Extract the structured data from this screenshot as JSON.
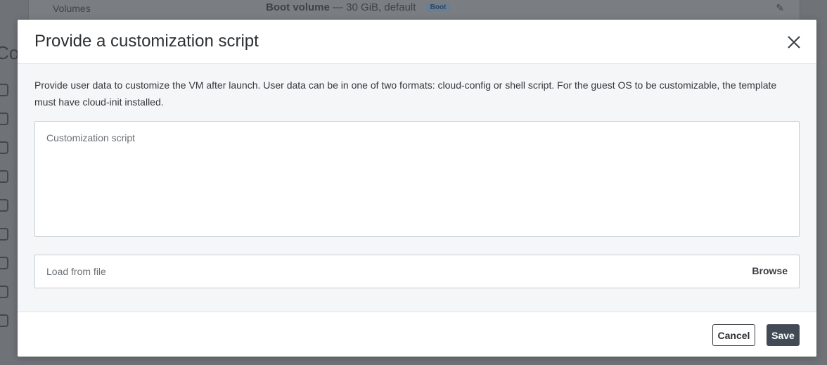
{
  "background": {
    "row_label": "Volumes",
    "row_value": "Boot volume",
    "row_sub": "— 30 GiB, default",
    "row_badge": "Boot",
    "side_heading": "Co"
  },
  "modal": {
    "title": "Provide a customization script",
    "description": "Provide user data to customize the VM after launch. User data can be in one of two formats: cloud-config or shell script. For the guest OS to be customizable, the template must have cloud-init installed.",
    "script_placeholder": "Customization script",
    "file_placeholder": "Load from file",
    "browse_label": "Browse",
    "cancel_label": "Cancel",
    "save_label": "Save"
  },
  "icons": {
    "close": "close-icon",
    "edit": "pencil-icon"
  },
  "colors": {
    "primary_button": "#424a55",
    "overlay": "#6f7378",
    "body_bg": "#f5f6f7"
  }
}
